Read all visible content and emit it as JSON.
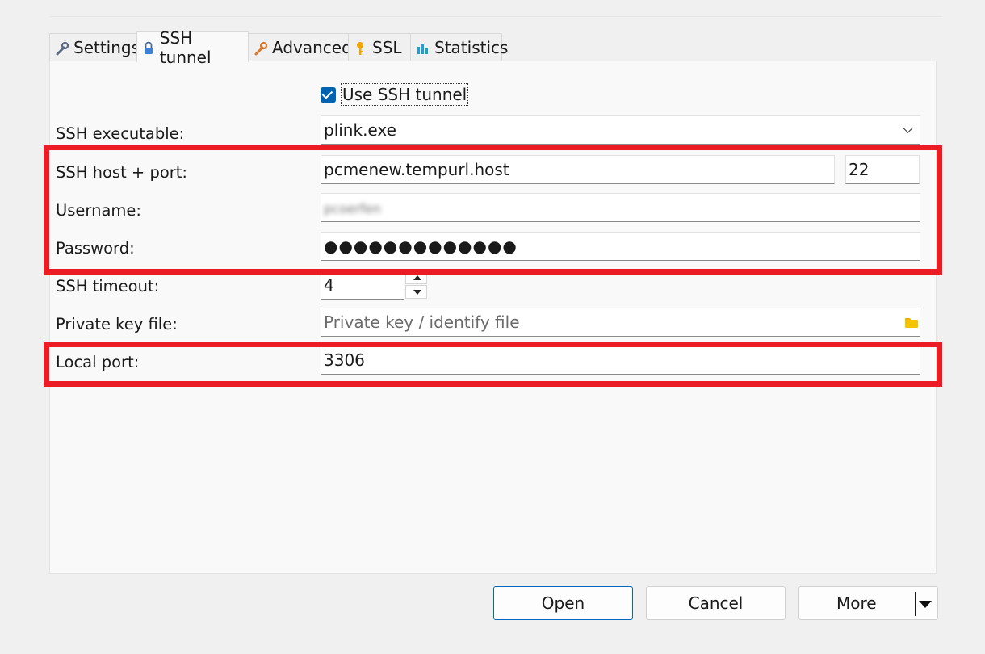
{
  "tabs": [
    {
      "label": "Settings",
      "icon": "wrench-icon",
      "active": false
    },
    {
      "label": "SSH tunnel",
      "icon": "lock-icon",
      "active": true
    },
    {
      "label": "Advanced",
      "icon": "wrench-orange-icon",
      "active": false
    },
    {
      "label": "SSL",
      "icon": "key-icon",
      "active": false
    },
    {
      "label": "Statistics",
      "icon": "bar-chart-icon",
      "active": false
    }
  ],
  "use_ssh": {
    "label": "Use SSH tunnel",
    "checked": true
  },
  "fields": {
    "ssh_executable": {
      "label": "SSH executable:",
      "value": "plink.exe"
    },
    "ssh_host_port": {
      "label": "SSH host + port:",
      "host": "pcmenew.tempurl.host",
      "port": "22"
    },
    "username": {
      "label": "Username:",
      "value": "pcoerfen"
    },
    "password": {
      "label": "Password:",
      "value": "●●●●●●●●●●●●●"
    },
    "ssh_timeout": {
      "label": "SSH timeout:",
      "value": "4"
    },
    "private_key": {
      "label": "Private key file:",
      "placeholder": "Private key / identify file"
    },
    "local_port": {
      "label": "Local port:",
      "value": "3306"
    }
  },
  "buttons": {
    "open": "Open",
    "cancel": "Cancel",
    "more": "More"
  },
  "colors": {
    "highlight": "#ec1c24",
    "accent": "#0063b1"
  }
}
